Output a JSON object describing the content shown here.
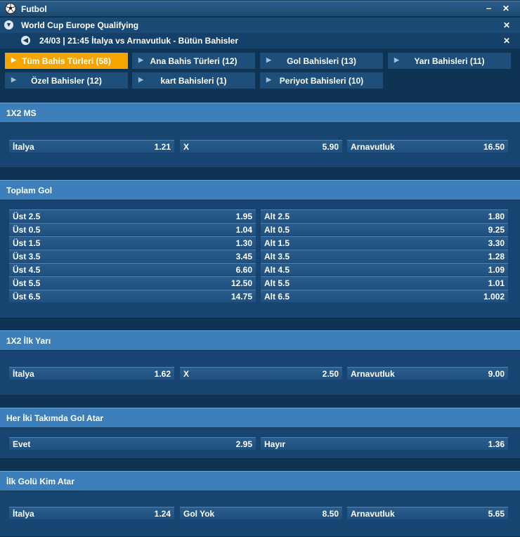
{
  "header": {
    "sport": "Futbol",
    "minimize_label": "–",
    "close_label": "✕",
    "league": "World Cup Europe Qualifying",
    "match": "24/03 | 21:45 İtalya vs Arnavutluk - Bütün Bahisler",
    "icons": [
      "soccer-ball-icon",
      "chevron-down-icon",
      "chevron-left-icon",
      "minimize-icon",
      "close-icon"
    ]
  },
  "tabs": [
    {
      "label": "Tüm Bahis Türleri (58)"
    },
    {
      "label": "Ana Bahis Türleri (12)"
    },
    {
      "label": "Gol Bahisleri (13)"
    },
    {
      "label": "Yarı Bahisleri (11)"
    },
    {
      "label": "Özel Bahisler (12)"
    },
    {
      "label": "kart Bahisleri (1)"
    },
    {
      "label": "Periyot Bahisleri (10)"
    }
  ],
  "colors": {
    "active_tab": "#f6a400",
    "market_header": "#3d7fba",
    "background": "#0f3453"
  },
  "markets": [
    {
      "title": "1X2 MS",
      "rows": [
        [
          {
            "label": "İtalya",
            "odd": "1.21"
          },
          {
            "label": "X",
            "odd": "5.90"
          },
          {
            "label": "Arnavutluk",
            "odd": "16.50"
          }
        ]
      ]
    },
    {
      "title": "Toplam Gol",
      "rows": [
        [
          {
            "label": "Üst 2.5",
            "odd": "1.95"
          },
          {
            "label": "Alt 2.5",
            "odd": "1.80"
          }
        ],
        [
          {
            "label": "Üst 0.5",
            "odd": "1.04"
          },
          {
            "label": "Alt 0.5",
            "odd": "9.25"
          }
        ],
        [
          {
            "label": "Üst 1.5",
            "odd": "1.30"
          },
          {
            "label": "Alt 1.5",
            "odd": "3.30"
          }
        ],
        [
          {
            "label": "Üst 3.5",
            "odd": "3.45"
          },
          {
            "label": "Alt 3.5",
            "odd": "1.28"
          }
        ],
        [
          {
            "label": "Üst 4.5",
            "odd": "6.60"
          },
          {
            "label": "Alt 4.5",
            "odd": "1.09"
          }
        ],
        [
          {
            "label": "Üst 5.5",
            "odd": "12.50"
          },
          {
            "label": "Alt 5.5",
            "odd": "1.01"
          }
        ],
        [
          {
            "label": "Üst 6.5",
            "odd": "14.75"
          },
          {
            "label": "Alt 6.5",
            "odd": "1.002"
          }
        ]
      ]
    },
    {
      "title": "1X2 İlk Yarı",
      "rows": [
        [
          {
            "label": "İtalya",
            "odd": "1.62"
          },
          {
            "label": "X",
            "odd": "2.50"
          },
          {
            "label": "Arnavutluk",
            "odd": "9.00"
          }
        ]
      ]
    },
    {
      "title": "Her İki Takımda Gol Atar",
      "rows": [
        [
          {
            "label": "Evet",
            "odd": "2.95"
          },
          {
            "label": "Hayır",
            "odd": "1.36"
          }
        ]
      ]
    },
    {
      "title": "İlk Golü Kim Atar",
      "rows": [
        [
          {
            "label": "İtalya",
            "odd": "1.24"
          },
          {
            "label": "Gol Yok",
            "odd": "8.50"
          },
          {
            "label": "Arnavutluk",
            "odd": "5.65"
          }
        ]
      ]
    }
  ]
}
